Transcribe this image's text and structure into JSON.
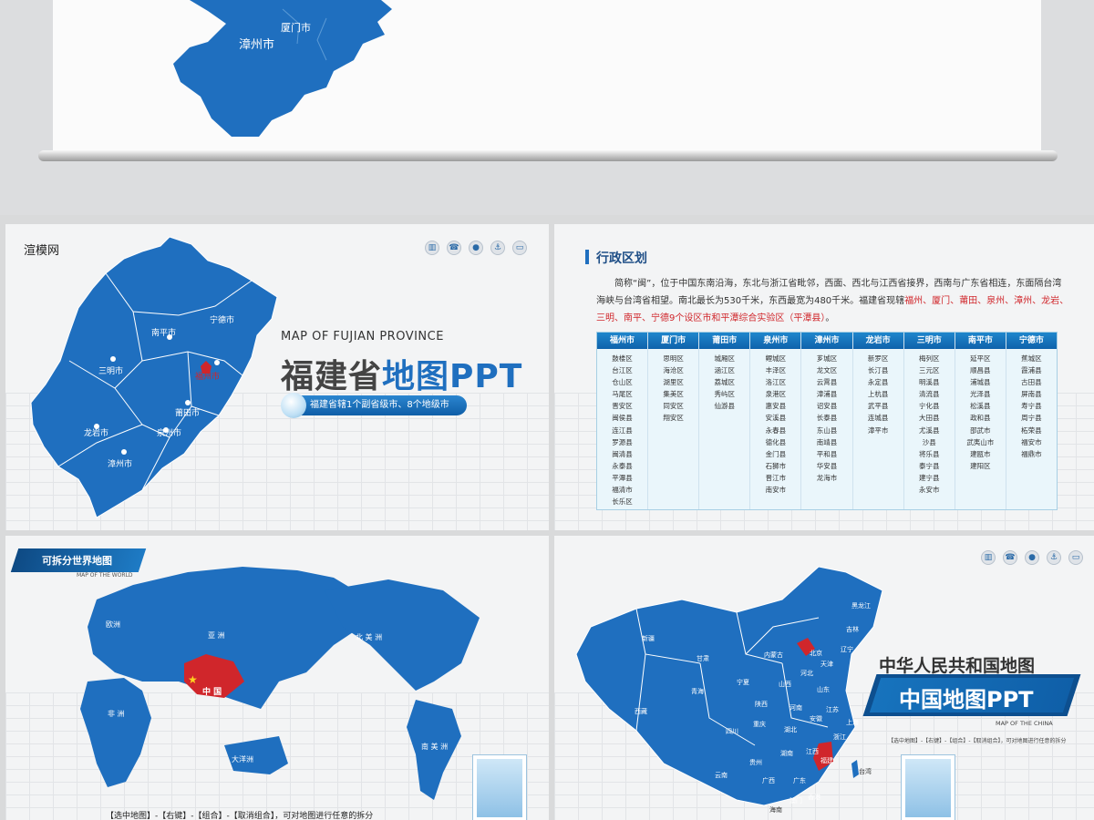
{
  "top_panel": {
    "labels": [
      "漳州市",
      "厦门市"
    ]
  },
  "fujian_slide": {
    "brand": "渲模网",
    "subtitle": "MAP OF FUJIAN PROVINCE",
    "title_main": "福建省",
    "title_highlight": "地图PPT",
    "pill_text": "福建省辖1个副省级市、8个地级市",
    "map_labels": [
      "宁德市",
      "南平市",
      "三明市",
      "福州市",
      "莆田市",
      "龙岩市",
      "泉州市",
      "漳州市"
    ],
    "toolbar_icons": [
      "chart-icon",
      "phone-icon",
      "user-icon",
      "anchor-icon",
      "cart-icon"
    ]
  },
  "division_slide": {
    "section_title": "行政区划",
    "paragraph_plain": "简称“闽”，位于中国东南沿海，东北与浙江省毗邻，西面、西北与江西省接界，西南与广东省相连，东面隔台湾海峡与台湾省相望。南北最长为530千米，东西最宽为480千米。福建省现辖",
    "paragraph_red": "福州、厦门、莆田、泉州、漳州、龙岩、三明、南平、宁德9个设区市和平潭综合实验区（平潭县）",
    "paragraph_end": "。",
    "table": [
      {
        "header": "福州市",
        "items": [
          "鼓楼区",
          "台江区",
          "仓山区",
          "马尾区",
          "晋安区",
          "闽侯县",
          "连江县",
          "罗源县",
          "闽清县",
          "永泰县",
          "平潭县",
          "福清市",
          "长乐区"
        ]
      },
      {
        "header": "厦门市",
        "items": [
          "思明区",
          "海沧区",
          "湖里区",
          "集美区",
          "同安区",
          "翔安区"
        ]
      },
      {
        "header": "莆田市",
        "items": [
          "城厢区",
          "涵江区",
          "荔城区",
          "秀屿区",
          "仙游县"
        ]
      },
      {
        "header": "泉州市",
        "items": [
          "鲤城区",
          "丰泽区",
          "洛江区",
          "泉港区",
          "惠安县",
          "安溪县",
          "永春县",
          "德化县",
          "金门县",
          "石狮市",
          "晋江市",
          "南安市"
        ]
      },
      {
        "header": "漳州市",
        "items": [
          "芗城区",
          "龙文区",
          "云霄县",
          "漳浦县",
          "诏安县",
          "长泰县",
          "东山县",
          "南靖县",
          "平和县",
          "华安县",
          "龙海市"
        ]
      },
      {
        "header": "龙岩市",
        "items": [
          "新罗区",
          "长汀县",
          "永定县",
          "上杭县",
          "武平县",
          "连城县",
          "漳平市"
        ]
      },
      {
        "header": "三明市",
        "items": [
          "梅列区",
          "三元区",
          "明溪县",
          "清流县",
          "宁化县",
          "大田县",
          "尤溪县",
          "沙县",
          "将乐县",
          "泰宁县",
          "建宁县",
          "永安市"
        ]
      },
      {
        "header": "南平市",
        "items": [
          "延平区",
          "顺昌县",
          "浦城县",
          "光泽县",
          "松溪县",
          "政和县",
          "邵武市",
          "武夷山市",
          "建瓯市",
          "建阳区"
        ]
      },
      {
        "header": "宁德市",
        "items": [
          "蕉城区",
          "霞浦县",
          "古田县",
          "屏南县",
          "寿宁县",
          "周宁县",
          "柘荣县",
          "福安市",
          "福鼎市"
        ]
      }
    ],
    "toolbar_icons": [
      "chart-icon",
      "phone-icon",
      "user-icon",
      "anchor-icon",
      "cart-icon"
    ]
  },
  "world_slide": {
    "ribbon_title": "可拆分世界地图",
    "ribbon_sub": "MAP OF THE WORLD",
    "labels": [
      "亚 洲",
      "欧洲",
      "非 洲",
      "大洋洲",
      "北 美 洲",
      "南 美 洲",
      "中 国"
    ],
    "bottom_text": "【选中地图】-【右键】-【组合】-【取消组合】，可对地图进行任意的拆分"
  },
  "china_slide": {
    "title": "中华人民共和国地图",
    "band_title": "中国地图PPT",
    "band_sub": "MAP OF THE CHINA",
    "hint": "【选中地图】-【右键】-【组合】-【取消组合】，可对地图进行任意的拆分",
    "labels": [
      "黑龙江",
      "吉林",
      "辽宁",
      "内蒙古",
      "新疆",
      "甘肃",
      "宁夏",
      "青海",
      "西藏",
      "四川",
      "重庆",
      "云南",
      "贵州",
      "广西",
      "广东",
      "湖南",
      "江西",
      "福建",
      "浙江",
      "上海",
      "江苏",
      "安徽",
      "湖北",
      "河南",
      "山东",
      "陕西",
      "山西",
      "河北",
      "北京",
      "天津",
      "海南",
      "台湾",
      "香港",
      "澳门"
    ],
    "toolbar_icons": [
      "chart-icon",
      "phone-icon",
      "user-icon",
      "anchor-icon",
      "cart-icon"
    ]
  },
  "colors": {
    "map_blue": "#1f6fbf",
    "highlight_red": "#d0262b"
  }
}
